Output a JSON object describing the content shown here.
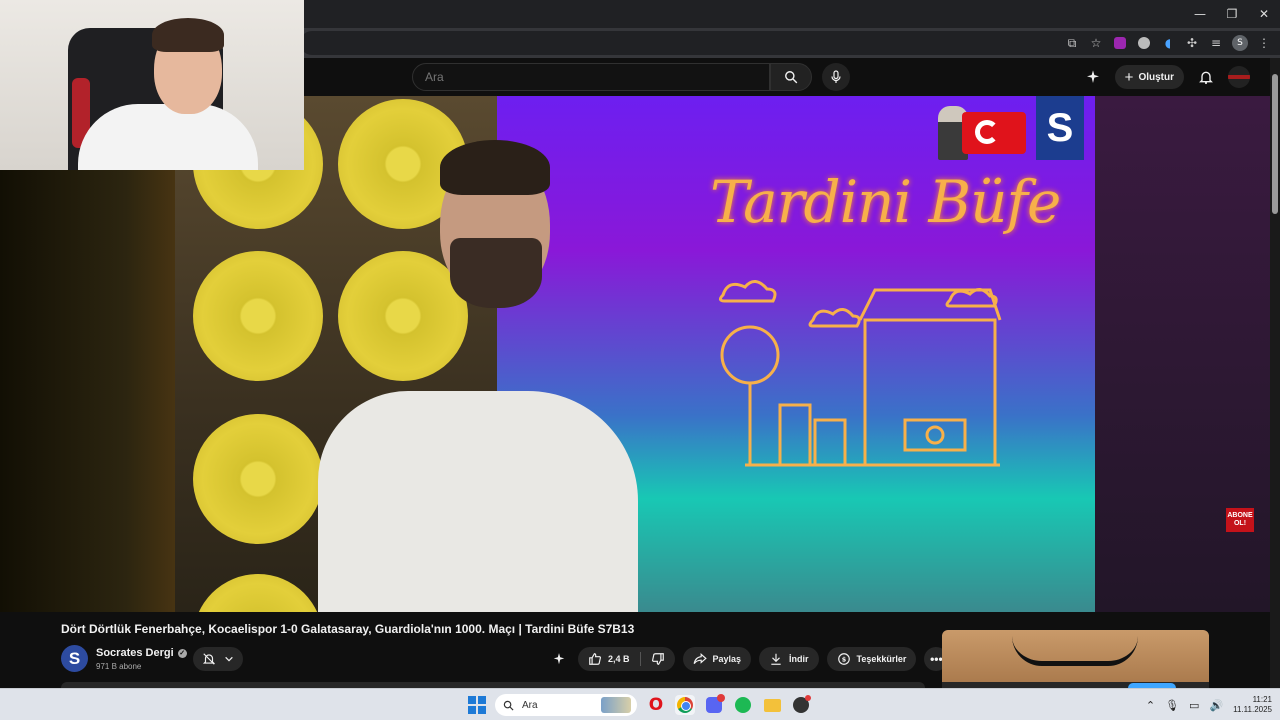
{
  "browser": {
    "window_controls": {
      "minimize": "—",
      "maximize": "❐",
      "close": "✕"
    }
  },
  "header": {
    "search_placeholder": "Ara",
    "create_label": "Oluştur"
  },
  "video": {
    "overlay_title": "Tardini Büfe",
    "logo_letter": "S",
    "subscribe_badge": "ABONE OL!"
  },
  "watch": {
    "title": "Dört Dörtlük Fenerbahçe, Kocaelispor 1-0 Galatasaray, Guardiola'nın 1000. Maçı | Tardini Büfe S7B13",
    "channel": {
      "avatar_letter": "S",
      "name": "Socrates Dergi",
      "subscribers": "971 B abone"
    },
    "actions": {
      "likes": "2,4 B",
      "share": "Paylaş",
      "download": "İndir",
      "thanks": "Teşekkürler",
      "more": "•••"
    }
  },
  "taskbar": {
    "search_label": "Ara",
    "time": "11:21",
    "date": "11.11.2025"
  },
  "colors": {
    "background": "#0f0f0f",
    "accent_blue": "#3ea6ff",
    "brand_red": "#c4121a",
    "neon_orange": "#f7b04a"
  }
}
